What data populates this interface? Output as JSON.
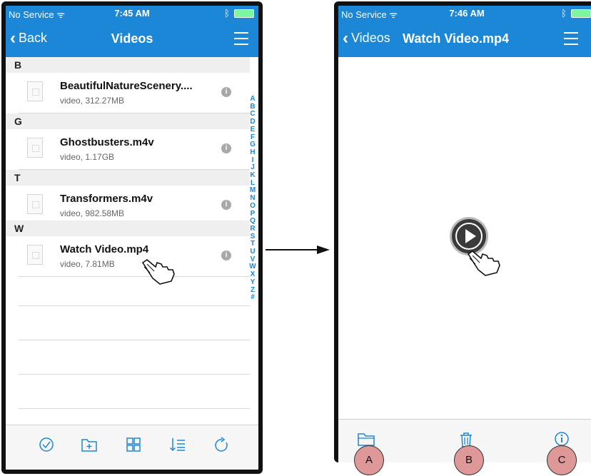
{
  "left_screen": {
    "status": {
      "carrier": "No Service",
      "wifi_glyph": "ᯤ",
      "time": "7:45 AM",
      "bluetooth_glyph": "ᛒ"
    },
    "nav": {
      "back_label": "Back",
      "title": "Videos"
    },
    "sections": [
      {
        "letter": "B",
        "file": {
          "name": "BeautifulNatureScenery....",
          "meta": "video, 312.27MB"
        }
      },
      {
        "letter": "G",
        "file": {
          "name": "Ghostbusters.m4v",
          "meta": "video, 1.17GB"
        }
      },
      {
        "letter": "T",
        "file": {
          "name": "Transformers.m4v",
          "meta": "video, 982.58MB"
        }
      },
      {
        "letter": "W",
        "file": {
          "name": "Watch Video.mp4",
          "meta": "video, 7.81MB"
        }
      }
    ],
    "index_letters": [
      "A",
      "B",
      "C",
      "D",
      "E",
      "F",
      "G",
      "H",
      "I",
      "J",
      "K",
      "L",
      "M",
      "N",
      "O",
      "P",
      "Q",
      "R",
      "S",
      "T",
      "U",
      "V",
      "W",
      "X",
      "Y",
      "Z",
      "#"
    ],
    "toolbar_icons": [
      "select-icon",
      "new-folder-icon",
      "grid-view-icon",
      "sort-icon",
      "refresh-icon"
    ],
    "toolbar_glyphs": [
      "⊘",
      "⊞",
      "⊞",
      "⇣",
      "↻"
    ]
  },
  "right_screen": {
    "status": {
      "carrier": "No Service",
      "wifi_glyph": "ᯤ",
      "time": "7:46 AM",
      "bluetooth_glyph": "ᛒ"
    },
    "nav": {
      "back_label": "Videos",
      "title": "Watch Video.mp4"
    },
    "toolbar_icons": [
      "folder-icon",
      "trash-icon",
      "info-icon"
    ],
    "toolbar_glyphs": [
      "🗀",
      "🗑",
      "ⓘ"
    ]
  },
  "callouts": [
    "A",
    "B",
    "C"
  ],
  "colors": {
    "accent": "#1b87d6",
    "callout": "#de9898",
    "section_bg": "#efefef"
  }
}
